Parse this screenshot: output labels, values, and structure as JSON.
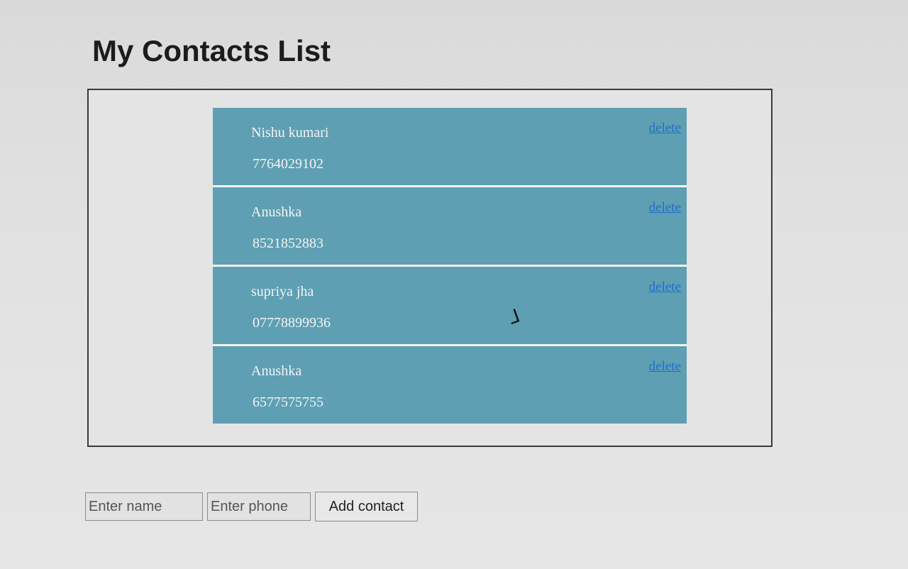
{
  "page": {
    "title": "My Contacts List"
  },
  "contacts": [
    {
      "name": "Nishu kumari",
      "phone": "7764029102",
      "delete_label": "delete"
    },
    {
      "name": "Anushka",
      "phone": "8521852883",
      "delete_label": "delete"
    },
    {
      "name": "supriya jha",
      "phone": "07778899936",
      "delete_label": "delete"
    },
    {
      "name": "Anushka",
      "phone": "6577575755",
      "delete_label": "delete"
    }
  ],
  "form": {
    "name_placeholder": "Enter name",
    "phone_placeholder": "Enter phone",
    "add_label": "Add contact"
  },
  "colors": {
    "item_background": "#5e9fb3",
    "delete_link": "#1f6fc9",
    "item_text": "#f4f4f4"
  }
}
